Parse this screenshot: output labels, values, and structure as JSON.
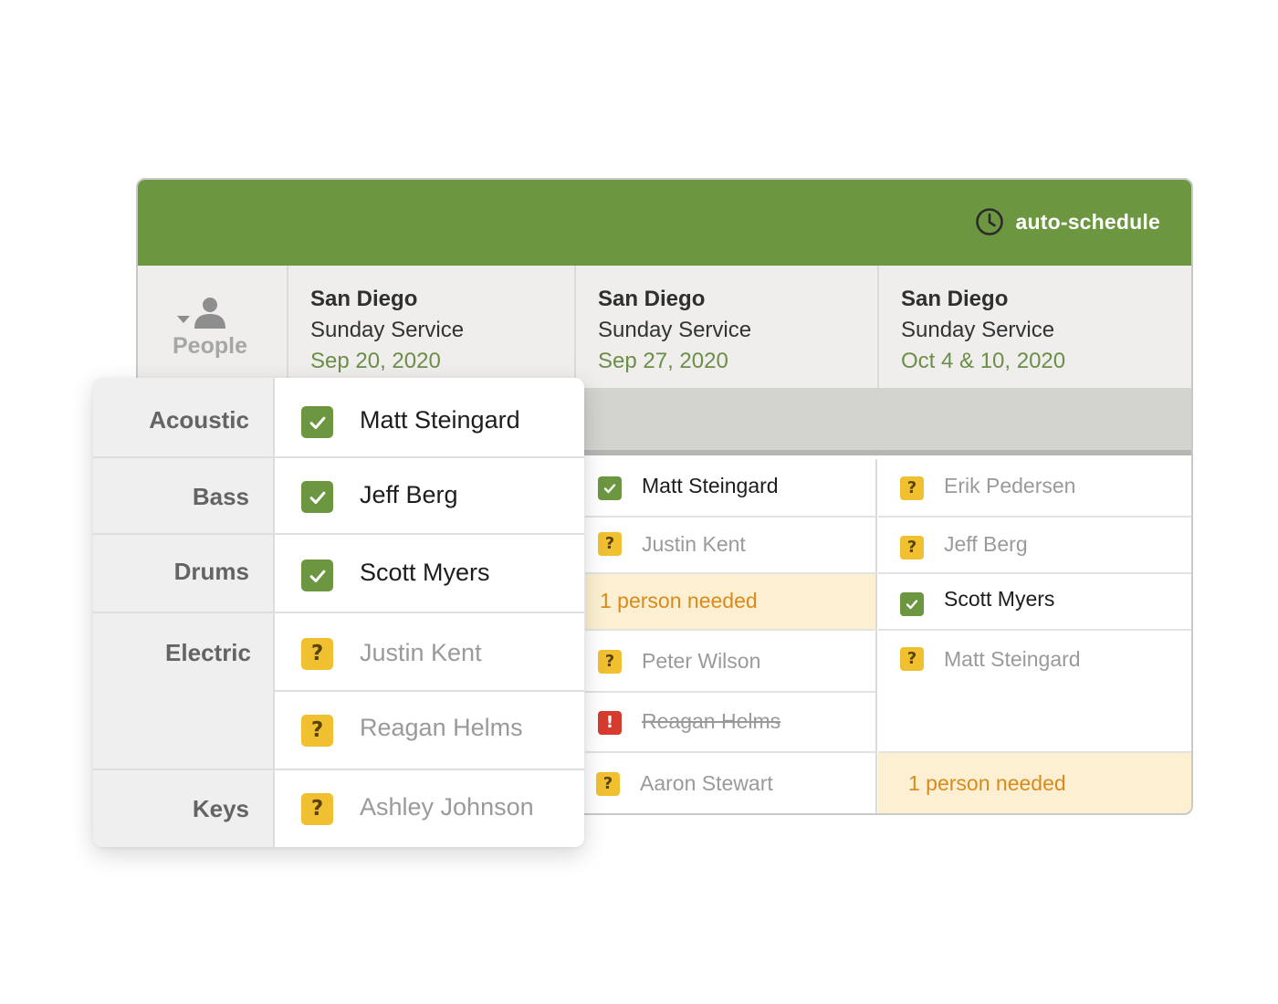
{
  "header": {
    "auto_schedule_label": "auto-schedule",
    "accent_color": "#6c9640"
  },
  "people_column": {
    "label": "People"
  },
  "plans": [
    {
      "location": "San Diego",
      "service": "Sunday Service",
      "date": "Sep 20, 2020"
    },
    {
      "location": "San Diego",
      "service": "Sunday Service",
      "date": "Sep 27, 2020"
    },
    {
      "location": "San Diego",
      "service": "Sunday Service",
      "date": "Oct 4 & 10, 2020"
    }
  ],
  "overlay": {
    "rows": [
      {
        "position": "Acoustic",
        "people": [
          {
            "name": "Matt Steingard",
            "status": "confirmed"
          }
        ]
      },
      {
        "position": "Bass",
        "people": [
          {
            "name": "Jeff Berg",
            "status": "confirmed"
          }
        ]
      },
      {
        "position": "Drums",
        "people": [
          {
            "name": "Scott Myers",
            "status": "confirmed"
          }
        ]
      },
      {
        "position": "Electric",
        "people": [
          {
            "name": "Justin Kent",
            "status": "unconfirmed"
          },
          {
            "name": "Reagan Helms",
            "status": "unconfirmed"
          }
        ]
      },
      {
        "position": "Keys",
        "people": [
          {
            "name": "Ashley Johnson",
            "status": "unconfirmed"
          }
        ]
      }
    ]
  },
  "plan2_cells": [
    {
      "name": "Matt Steingard",
      "status": "confirmed"
    },
    {
      "name": "Justin Kent",
      "status": "unconfirmed"
    },
    {
      "name": "1 person needed",
      "status": "needed"
    },
    {
      "name": "Peter Wilson",
      "status": "unconfirmed"
    },
    {
      "name": "Reagan Helms",
      "status": "declined"
    },
    {
      "name": "Aaron Stewart",
      "status": "unconfirmed"
    }
  ],
  "plan3_cells": [
    {
      "name": "Erik Pedersen",
      "status": "unconfirmed"
    },
    {
      "name": "Jeff Berg",
      "status": "unconfirmed"
    },
    {
      "name": "Scott Myers",
      "status": "confirmed"
    },
    {
      "name": "Matt Steingard",
      "status": "unconfirmed"
    },
    {
      "name": "1 person needed",
      "status": "needed"
    }
  ],
  "status_colors": {
    "confirmed": "#6c9640",
    "unconfirmed": "#f0c031",
    "declined": "#d63b2f",
    "needed_bg": "#fdf0d2",
    "needed_text": "#d98a1c"
  },
  "status_icons": {
    "confirmed": "check-icon",
    "unconfirmed": "question-icon",
    "declined": "exclamation-icon"
  }
}
